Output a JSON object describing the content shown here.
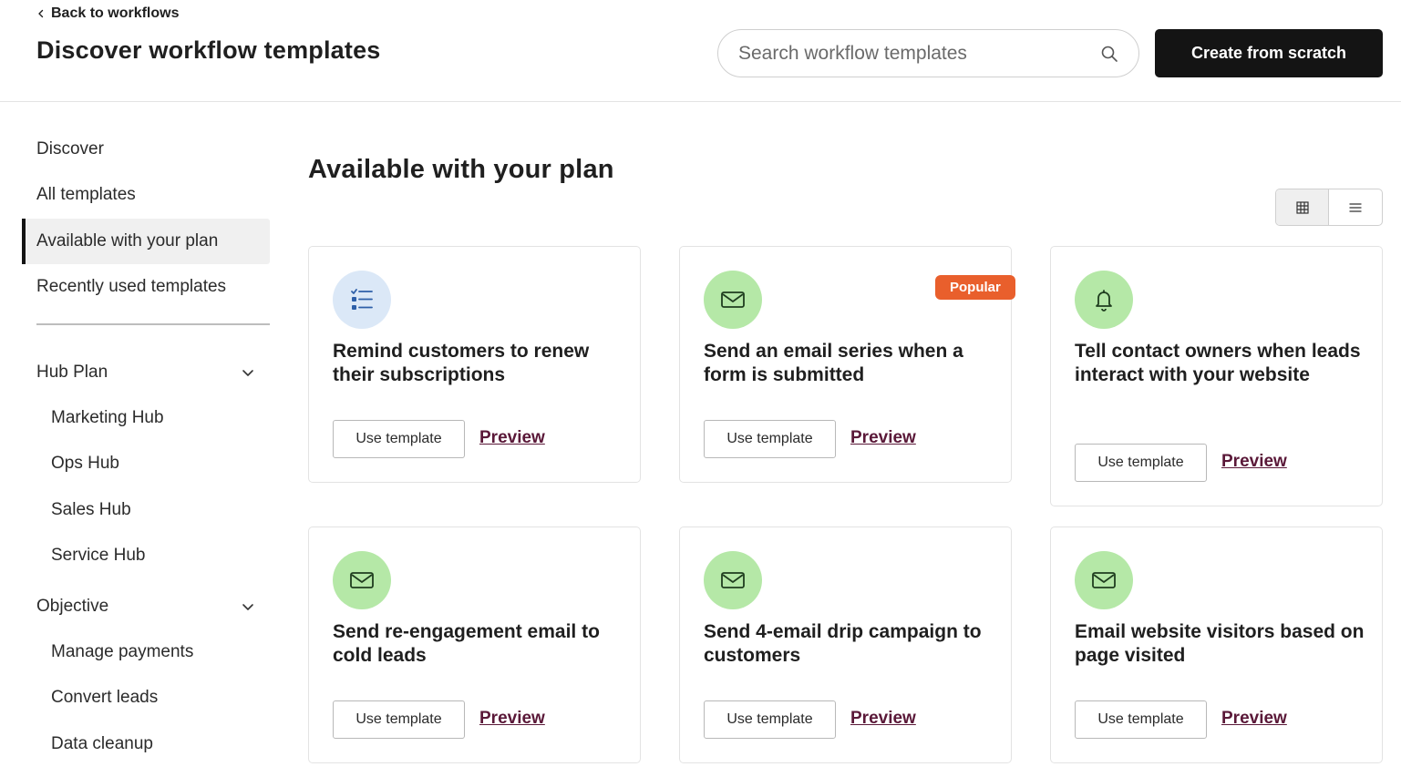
{
  "header": {
    "back_label": "Back to workflows",
    "title": "Discover workflow templates",
    "search_placeholder": "Search workflow templates",
    "create_label": "Create from scratch"
  },
  "sidebar": {
    "items": [
      {
        "label": "Discover",
        "active": false
      },
      {
        "label": "All templates",
        "active": false
      },
      {
        "label": "Available with your plan",
        "active": true
      },
      {
        "label": "Recently used templates",
        "active": false
      }
    ],
    "hub_group": {
      "label": "Hub Plan",
      "items": [
        "Marketing Hub",
        "Ops Hub",
        "Sales Hub",
        "Service Hub"
      ]
    },
    "objective_group": {
      "label": "Objective",
      "items": [
        "Manage payments",
        "Convert leads",
        "Data cleanup"
      ]
    }
  },
  "main": {
    "section_title": "Available with your plan",
    "view_modes": {
      "active": "grid",
      "icons": [
        "grid-icon",
        "list-icon"
      ]
    },
    "use_label": "Use template",
    "preview_label": "Preview",
    "cards": [
      {
        "title": "Remind customers to renew their subscriptions",
        "icon": "checklist-icon",
        "icon_bg": "#dbe8f7",
        "badge": ""
      },
      {
        "title": "Send an email series when a form is submitted",
        "icon": "envelope-icon",
        "icon_bg": "#b5e8a7",
        "badge": "Popular"
      },
      {
        "title": "Tell contact owners when leads interact with your website",
        "icon": "bell-icon",
        "icon_bg": "#b5e8a7",
        "badge": ""
      },
      {
        "title": "Send re-engagement email to cold leads",
        "icon": "envelope-icon",
        "icon_bg": "#b5e8a7",
        "badge": ""
      },
      {
        "title": "Send 4-email drip campaign to customers",
        "icon": "envelope-icon",
        "icon_bg": "#b5e8a7",
        "badge": ""
      },
      {
        "title": "Email website visitors based on page visited",
        "icon": "envelope-icon",
        "icon_bg": "#b5e8a7",
        "badge": ""
      }
    ]
  },
  "colors": {
    "primary_button": "#141414",
    "badge": "#e95f2c",
    "preview_link": "#5a1838",
    "icon_green": "#b5e8a7",
    "icon_blue": "#dbe8f7"
  }
}
